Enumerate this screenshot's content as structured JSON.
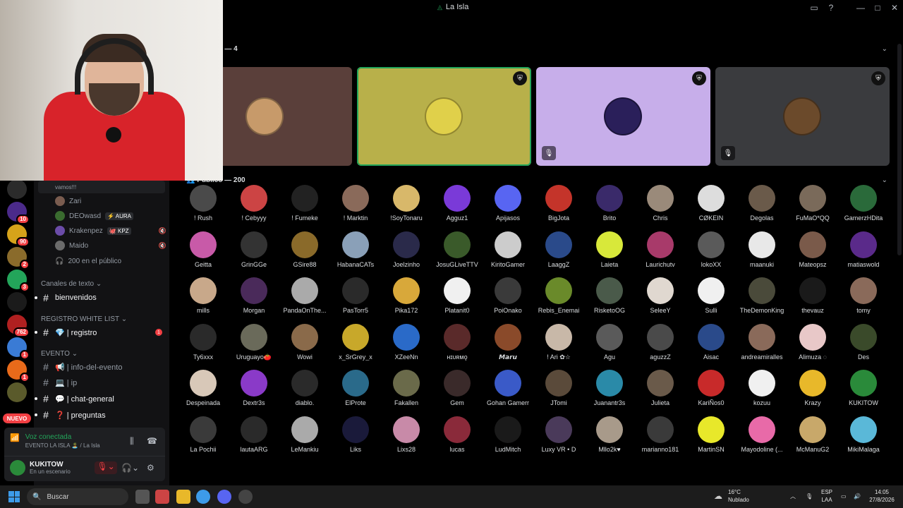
{
  "window": {
    "title": "La Isla"
  },
  "stage": {
    "speakers_header": "s — 4",
    "audience_header": "Público — 200"
  },
  "sidebar": {
    "message_snippet": "vamos!!!",
    "voice_users": [
      {
        "name": "Zari",
        "tag": "",
        "color": "#7a5c4f"
      },
      {
        "name": "DEOwasd",
        "tag": "⚡ AURA",
        "color": "#3a6b2f"
      },
      {
        "name": "Krakenpez",
        "tag": "🐙 KPZ",
        "color": "#6b4ca8"
      },
      {
        "name": "Maido",
        "tag": "",
        "color": "#6b6b6b"
      }
    ],
    "public_count_label": "200 en el público",
    "cat_text": "Canales de texto",
    "ch_bienvenidos": "bienvenidos",
    "cat_registro": "REGISTRO WHITE LIST",
    "ch_registro": "💎 | registro",
    "ch_registro_badge": "1",
    "cat_evento": "EVENTO",
    "ch_info": "📢 | info-del-evento",
    "ch_ip": "💻 | ip",
    "ch_chat": "💬 | chat-general",
    "ch_preguntas": "❓ | preguntas",
    "nuevo": "NUEVO"
  },
  "servers": [
    {
      "color": "#2b2b2b",
      "badge": ""
    },
    {
      "color": "#4b2a8a",
      "badge": "10"
    },
    {
      "color": "#d6a31a",
      "badge": "90"
    },
    {
      "color": "#8a6b2b",
      "badge": "2"
    },
    {
      "color": "#23a55a",
      "badge": "3"
    },
    {
      "color": "#1b1b1b",
      "badge": ""
    },
    {
      "color": "#b02020",
      "badge": "762"
    },
    {
      "color": "#3a7bd5",
      "badge": "1"
    },
    {
      "color": "#e86a1a",
      "badge": "1"
    },
    {
      "color": "#5a5a2b",
      "badge": ""
    }
  ],
  "voice_panel": {
    "status": "Voz conectada",
    "channel": "EVENTO LA ISLA 🏝️ / La Isla",
    "username": "KUKITOW",
    "user_status": "En un escenario"
  },
  "speakers": [
    {
      "bg": "#5a3f3a",
      "avatar": "#c79a6a",
      "moderator": false,
      "muted": false,
      "highlight": false
    },
    {
      "bg": "#b8b04a",
      "avatar": "#e0d04a",
      "moderator": true,
      "muted": false,
      "highlight": true
    },
    {
      "bg": "#c7aeea",
      "avatar": "#2a1f5a",
      "moderator": true,
      "muted": true,
      "highlight": false
    },
    {
      "bg": "#3a3b3e",
      "avatar": "#6b4a2b",
      "moderator": true,
      "muted": true,
      "highlight": false
    }
  ],
  "audience": [
    {
      "name": "! Rush",
      "color": "#4a4a4a"
    },
    {
      "name": "! Cebyyy",
      "color": "#c44"
    },
    {
      "name": "! Fumeke",
      "color": "#222"
    },
    {
      "name": "! Marktin",
      "color": "#8a6a5a"
    },
    {
      "name": "!SoyTonaru",
      "color": "#d8b86a"
    },
    {
      "name": "Agguz1",
      "color": "#7a3ad8"
    },
    {
      "name": "Apijasos",
      "color": "#5865f2"
    },
    {
      "name": "BigJota",
      "color": "#c4342a"
    },
    {
      "name": "Brito",
      "color": "#3a2a6a"
    },
    {
      "name": "Chris",
      "color": "#9a8a7a"
    },
    {
      "name": "CØKEIN",
      "color": "#ddd"
    },
    {
      "name": "Degolas",
      "color": "#6a5a4a"
    },
    {
      "name": "FuMaO*QQ",
      "color": "#7a6a5a"
    },
    {
      "name": "GamerzHDita",
      "color": "#2a6a3a"
    },
    {
      "name": "Geitta",
      "color": "#c85aa8"
    },
    {
      "name": "GrinGGe",
      "color": "#333"
    },
    {
      "name": "GSire88",
      "color": "#8a6a2a"
    },
    {
      "name": "HabanaCATs",
      "color": "#8aa0b8"
    },
    {
      "name": "Joelzinho",
      "color": "#2a2a4a"
    },
    {
      "name": "JosuGLiveTTV",
      "color": "#3a5a2a"
    },
    {
      "name": "KiritoGamer",
      "color": "#ccc"
    },
    {
      "name": "LaaggZ",
      "color": "#2a4a8a"
    },
    {
      "name": "Laieta",
      "color": "#d8e83a"
    },
    {
      "name": "Laurichutv",
      "color": "#a83a6a"
    },
    {
      "name": "lokoXX",
      "color": "#5a5a5a"
    },
    {
      "name": "maanuki",
      "color": "#e8e8e8"
    },
    {
      "name": "Mateopsz",
      "color": "#7a5a4a"
    },
    {
      "name": "matiaswold",
      "color": "#5a2a8a"
    },
    {
      "name": "mills",
      "color": "#c8a88a"
    },
    {
      "name": "Morgan",
      "color": "#4a2a5a"
    },
    {
      "name": "PandaOnThe...",
      "color": "#aaa"
    },
    {
      "name": "PasTorr5",
      "color": "#2a2a2a"
    },
    {
      "name": "Pika172",
      "color": "#d8a83a"
    },
    {
      "name": "Platanit0",
      "color": "#f0f0f0"
    },
    {
      "name": "PoiOnako",
      "color": "#3a3a3a"
    },
    {
      "name": "Rebis_Enemai",
      "color": "#6a8a2a"
    },
    {
      "name": "RisketoOG",
      "color": "#4a5a4a"
    },
    {
      "name": "SeleeY",
      "color": "#e0d8d0"
    },
    {
      "name": "Sulli",
      "color": "#f0f0f0"
    },
    {
      "name": "TheDemonKing",
      "color": "#4a4a3a"
    },
    {
      "name": "thevauz",
      "color": "#1a1a1a"
    },
    {
      "name": "tomy",
      "color": "#8a6a5a"
    },
    {
      "name": "Ty6xxx",
      "color": "#2a2a2a"
    },
    {
      "name": "Uruguayo🍅",
      "color": "#6a6a5a"
    },
    {
      "name": "Wowi",
      "color": "#8a6a4a"
    },
    {
      "name": "x_SrGrey_x",
      "color": "#c8a82a"
    },
    {
      "name": "XZeeNn",
      "color": "#2a6ac8"
    },
    {
      "name": "ʜɪᴜʀᴍǫ",
      "color": "#5a2a2a"
    },
    {
      "name": "𝙈𝙖𝙧𝙪",
      "color": "#8a4a2a"
    },
    {
      "name": "! Ari ✿☆",
      "color": "#c8b8a8"
    },
    {
      "name": "Agu",
      "color": "#5a5a5a"
    },
    {
      "name": "aguzzZ",
      "color": "#4a4a4a"
    },
    {
      "name": "Aisac",
      "color": "#2a4a8a"
    },
    {
      "name": "andreamiralles",
      "color": "#8a6a5a"
    },
    {
      "name": "Alimuza ◌",
      "color": "#e8c8c8"
    },
    {
      "name": "Des",
      "color": "#3a4a2a"
    },
    {
      "name": "Despeinada",
      "color": "#d8c8b8"
    },
    {
      "name": "Dextr3s",
      "color": "#8a3ac8"
    },
    {
      "name": "diablo.",
      "color": "#2a2a2a"
    },
    {
      "name": "ElProte",
      "color": "#2a6a8a"
    },
    {
      "name": "Fakallen",
      "color": "#6a6a4a"
    },
    {
      "name": "Gem",
      "color": "#3a2a2a"
    },
    {
      "name": "Gohan Gamerr",
      "color": "#3a5ac8"
    },
    {
      "name": "JTomi",
      "color": "#5a4a3a"
    },
    {
      "name": "Juanantr3s",
      "color": "#2a8aa8"
    },
    {
      "name": "Julieta",
      "color": "#6a5a4a"
    },
    {
      "name": "KariÑos0",
      "color": "#c82a2a"
    },
    {
      "name": "kozuu",
      "color": "#f0f0f0"
    },
    {
      "name": "Krazy",
      "color": "#e8b82a"
    },
    {
      "name": "KUKITOW",
      "color": "#2a8a3a"
    },
    {
      "name": "La Pochii",
      "color": "#3a3a3a"
    },
    {
      "name": "lautaARG",
      "color": "#2a2a2a"
    },
    {
      "name": "LeMankiu",
      "color": "#aaa"
    },
    {
      "name": "Liks",
      "color": "#1a1a3a"
    },
    {
      "name": "Lixs28",
      "color": "#c88aa8"
    },
    {
      "name": "lucas",
      "color": "#8a2a3a"
    },
    {
      "name": "LudMitch",
      "color": "#1a1a1a"
    },
    {
      "name": "Luxy VR • D",
      "color": "#4a3a5a"
    },
    {
      "name": "Mllo2k♥",
      "color": "#a89a8a"
    },
    {
      "name": "marianno181",
      "color": "#3a3a3a"
    },
    {
      "name": "MartinSN",
      "color": "#e8e82a"
    },
    {
      "name": "Mayodoline (...",
      "color": "#e86aa8"
    },
    {
      "name": "McManuG2",
      "color": "#c8a86a"
    },
    {
      "name": "MikiMalaga",
      "color": "#5ab8d8"
    }
  ],
  "taskbar": {
    "search": "Buscar",
    "temp": "16°C",
    "weather": "Nublado",
    "lang1": "ESP",
    "lang2": "LAA",
    "time": "14:05",
    "date": "27/8/2026"
  }
}
